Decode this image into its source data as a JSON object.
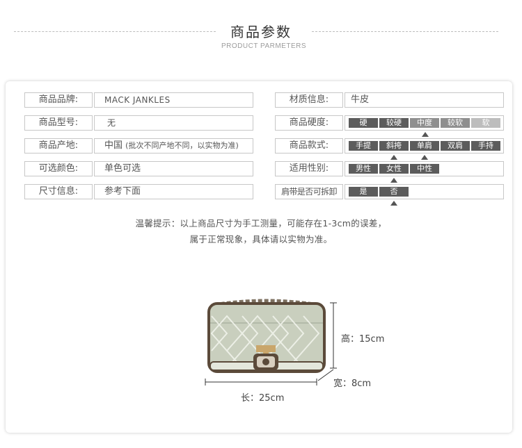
{
  "header": {
    "title": "商品参数",
    "subtitle": "PRODUCT PARMETERS"
  },
  "left_rows": [
    {
      "label": "商品品牌:",
      "value": "MACK JANKLES"
    },
    {
      "label": "商品型号:",
      "value": "无"
    },
    {
      "label": "商品产地:",
      "value": "中国",
      "note": "(批次不同产地不同，以实物为准)"
    },
    {
      "label": "可选颜色:",
      "value": "单色可选"
    },
    {
      "label": "尺寸信息:",
      "value": "参考下面"
    }
  ],
  "right_rows": [
    {
      "label": "材质信息:",
      "value": "牛皮"
    },
    {
      "label": "商品硬度:",
      "options": [
        "硬",
        "较硬",
        "中度",
        "较软",
        "软"
      ],
      "selected": "中度"
    },
    {
      "label": "商品款式:",
      "options": [
        "手提",
        "斜挎",
        "单肩",
        "双肩",
        "手持"
      ],
      "selected": [
        "斜挎",
        "单肩"
      ]
    },
    {
      "label": "适用性别:",
      "options": [
        "男性",
        "女性",
        "中性"
      ],
      "selected": "女性"
    },
    {
      "label": "肩带是否可拆卸",
      "options": [
        "是",
        "否"
      ],
      "selected": "否"
    }
  ],
  "tip": {
    "line1": "温馨提示：以上商品尺寸为手工测量，可能存在1-3cm的误差，",
    "line2": "属于正常现象，具体请以实物为准。"
  },
  "dimensions": {
    "height": "高：15cm",
    "width": "宽：8cm",
    "length": "长：25cm"
  },
  "colors": {
    "dark_segment": "#5c5c5c",
    "mid_segment": "#8f8f8f",
    "light_segment": "#bdbdbd",
    "bag_body": "#c9cfbe",
    "bag_trim": "#5b4a3a",
    "clasp": "#c9a66b"
  }
}
